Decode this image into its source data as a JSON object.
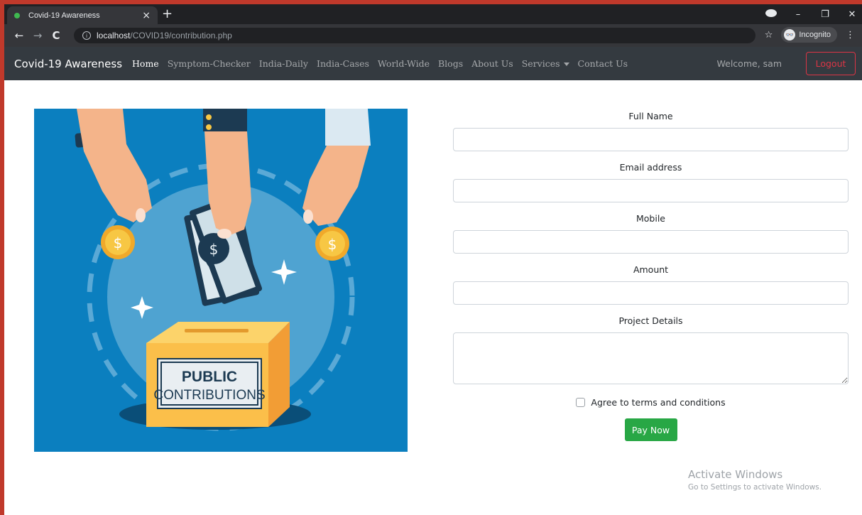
{
  "browser": {
    "tab_title": "Covid-19 Awareness",
    "tab_close": "×",
    "new_tab": "+",
    "url_host": "localhost",
    "url_path": "/COVID19/contribution.php",
    "incognito_label": "Incognito",
    "window_controls": {
      "minimize": "–",
      "restore": "❐",
      "close": "✕"
    },
    "star": "☆",
    "menu": "⋮",
    "back": "←",
    "forward": "→",
    "reload": "C",
    "info": "i"
  },
  "navbar": {
    "brand": "Covid-19 Awareness",
    "links": [
      {
        "label": "Home",
        "active": true
      },
      {
        "label": "Symptom-Checker"
      },
      {
        "label": "India-Daily"
      },
      {
        "label": "India-Cases"
      },
      {
        "label": "World-Wide"
      },
      {
        "label": "Blogs"
      },
      {
        "label": "About Us"
      },
      {
        "label": "Services",
        "dropdown": true
      },
      {
        "label": "Contact Us"
      }
    ],
    "welcome": "Welcome, sam",
    "logout": "Logout"
  },
  "illustration": {
    "box_text_line1": "PUBLIC",
    "box_text_line2": "CONTRIBUTIONS",
    "coin_symbol": "$",
    "colors": {
      "background": "#0b7fbf",
      "circle": "#4fa3d1",
      "box": "#fbbf4a",
      "coin": "#f7c744"
    }
  },
  "form": {
    "full_name_label": "Full Name",
    "email_label": "Email address",
    "mobile_label": "Mobile",
    "amount_label": "Amount",
    "project_details_label": "Project Details",
    "terms_label": "Agree to terms and conditions",
    "submit": "Pay Now"
  },
  "watermark": {
    "title": "Activate Windows",
    "subtitle": "Go to Settings to activate Windows."
  },
  "colors": {
    "navbar_bg": "#343a40",
    "logout": "#dc3545",
    "pay_button": "#28a745",
    "frame": "#c0392b"
  }
}
